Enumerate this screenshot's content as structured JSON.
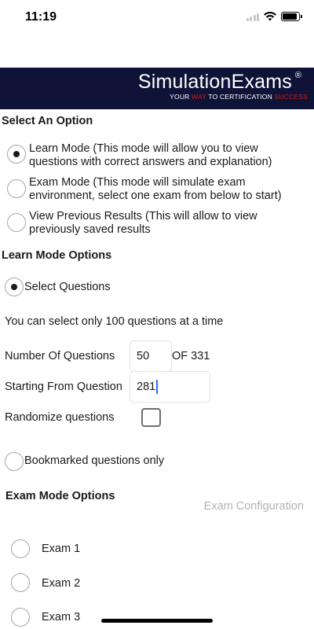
{
  "status": {
    "time": "11:19"
  },
  "banner": {
    "title": "SimulationExams",
    "reg_mark": "®",
    "tagline_1": "YOUR ",
    "tagline_2": "WAY",
    "tagline_3": " TO CERTIFICATION ",
    "tagline_4": "SUCCESS"
  },
  "select_option": {
    "title": "Select An Option",
    "learn_mode_line1": "Learn Mode (This mode will allow you to view",
    "learn_mode_line2": "questions with correct answers and explanation)",
    "exam_mode_line1": "Exam Mode (This mode will simulate exam",
    "exam_mode_line2": "environment, select one exam from below to start)",
    "previous_line1": "View Previous Results (This will allow to view",
    "previous_line2": "previously saved results",
    "selected": "learn_mode"
  },
  "learn_options": {
    "title": "Learn Mode Options",
    "select_questions": "Select Questions",
    "limit_note": "You can select only 100 questions at a time",
    "number_label": "Number Of Questions",
    "number_value": "50",
    "of_total": "OF 331",
    "starting_label": "Starting From Question",
    "starting_value": "281",
    "randomize_label": "Randomize questions",
    "randomize_checked": false,
    "bookmarked": "Bookmarked questions only",
    "selected": "select_questions"
  },
  "exam_options": {
    "title": "Exam Mode Options",
    "config_link": "Exam Configuration",
    "exams": [
      "Exam 1",
      "Exam 2",
      "Exam 3"
    ]
  },
  "colors": {
    "banner_bg": "#0e1337",
    "accent_red": "#d21c1c",
    "caret": "#2a6ef5",
    "muted": "#b3b3b3"
  }
}
